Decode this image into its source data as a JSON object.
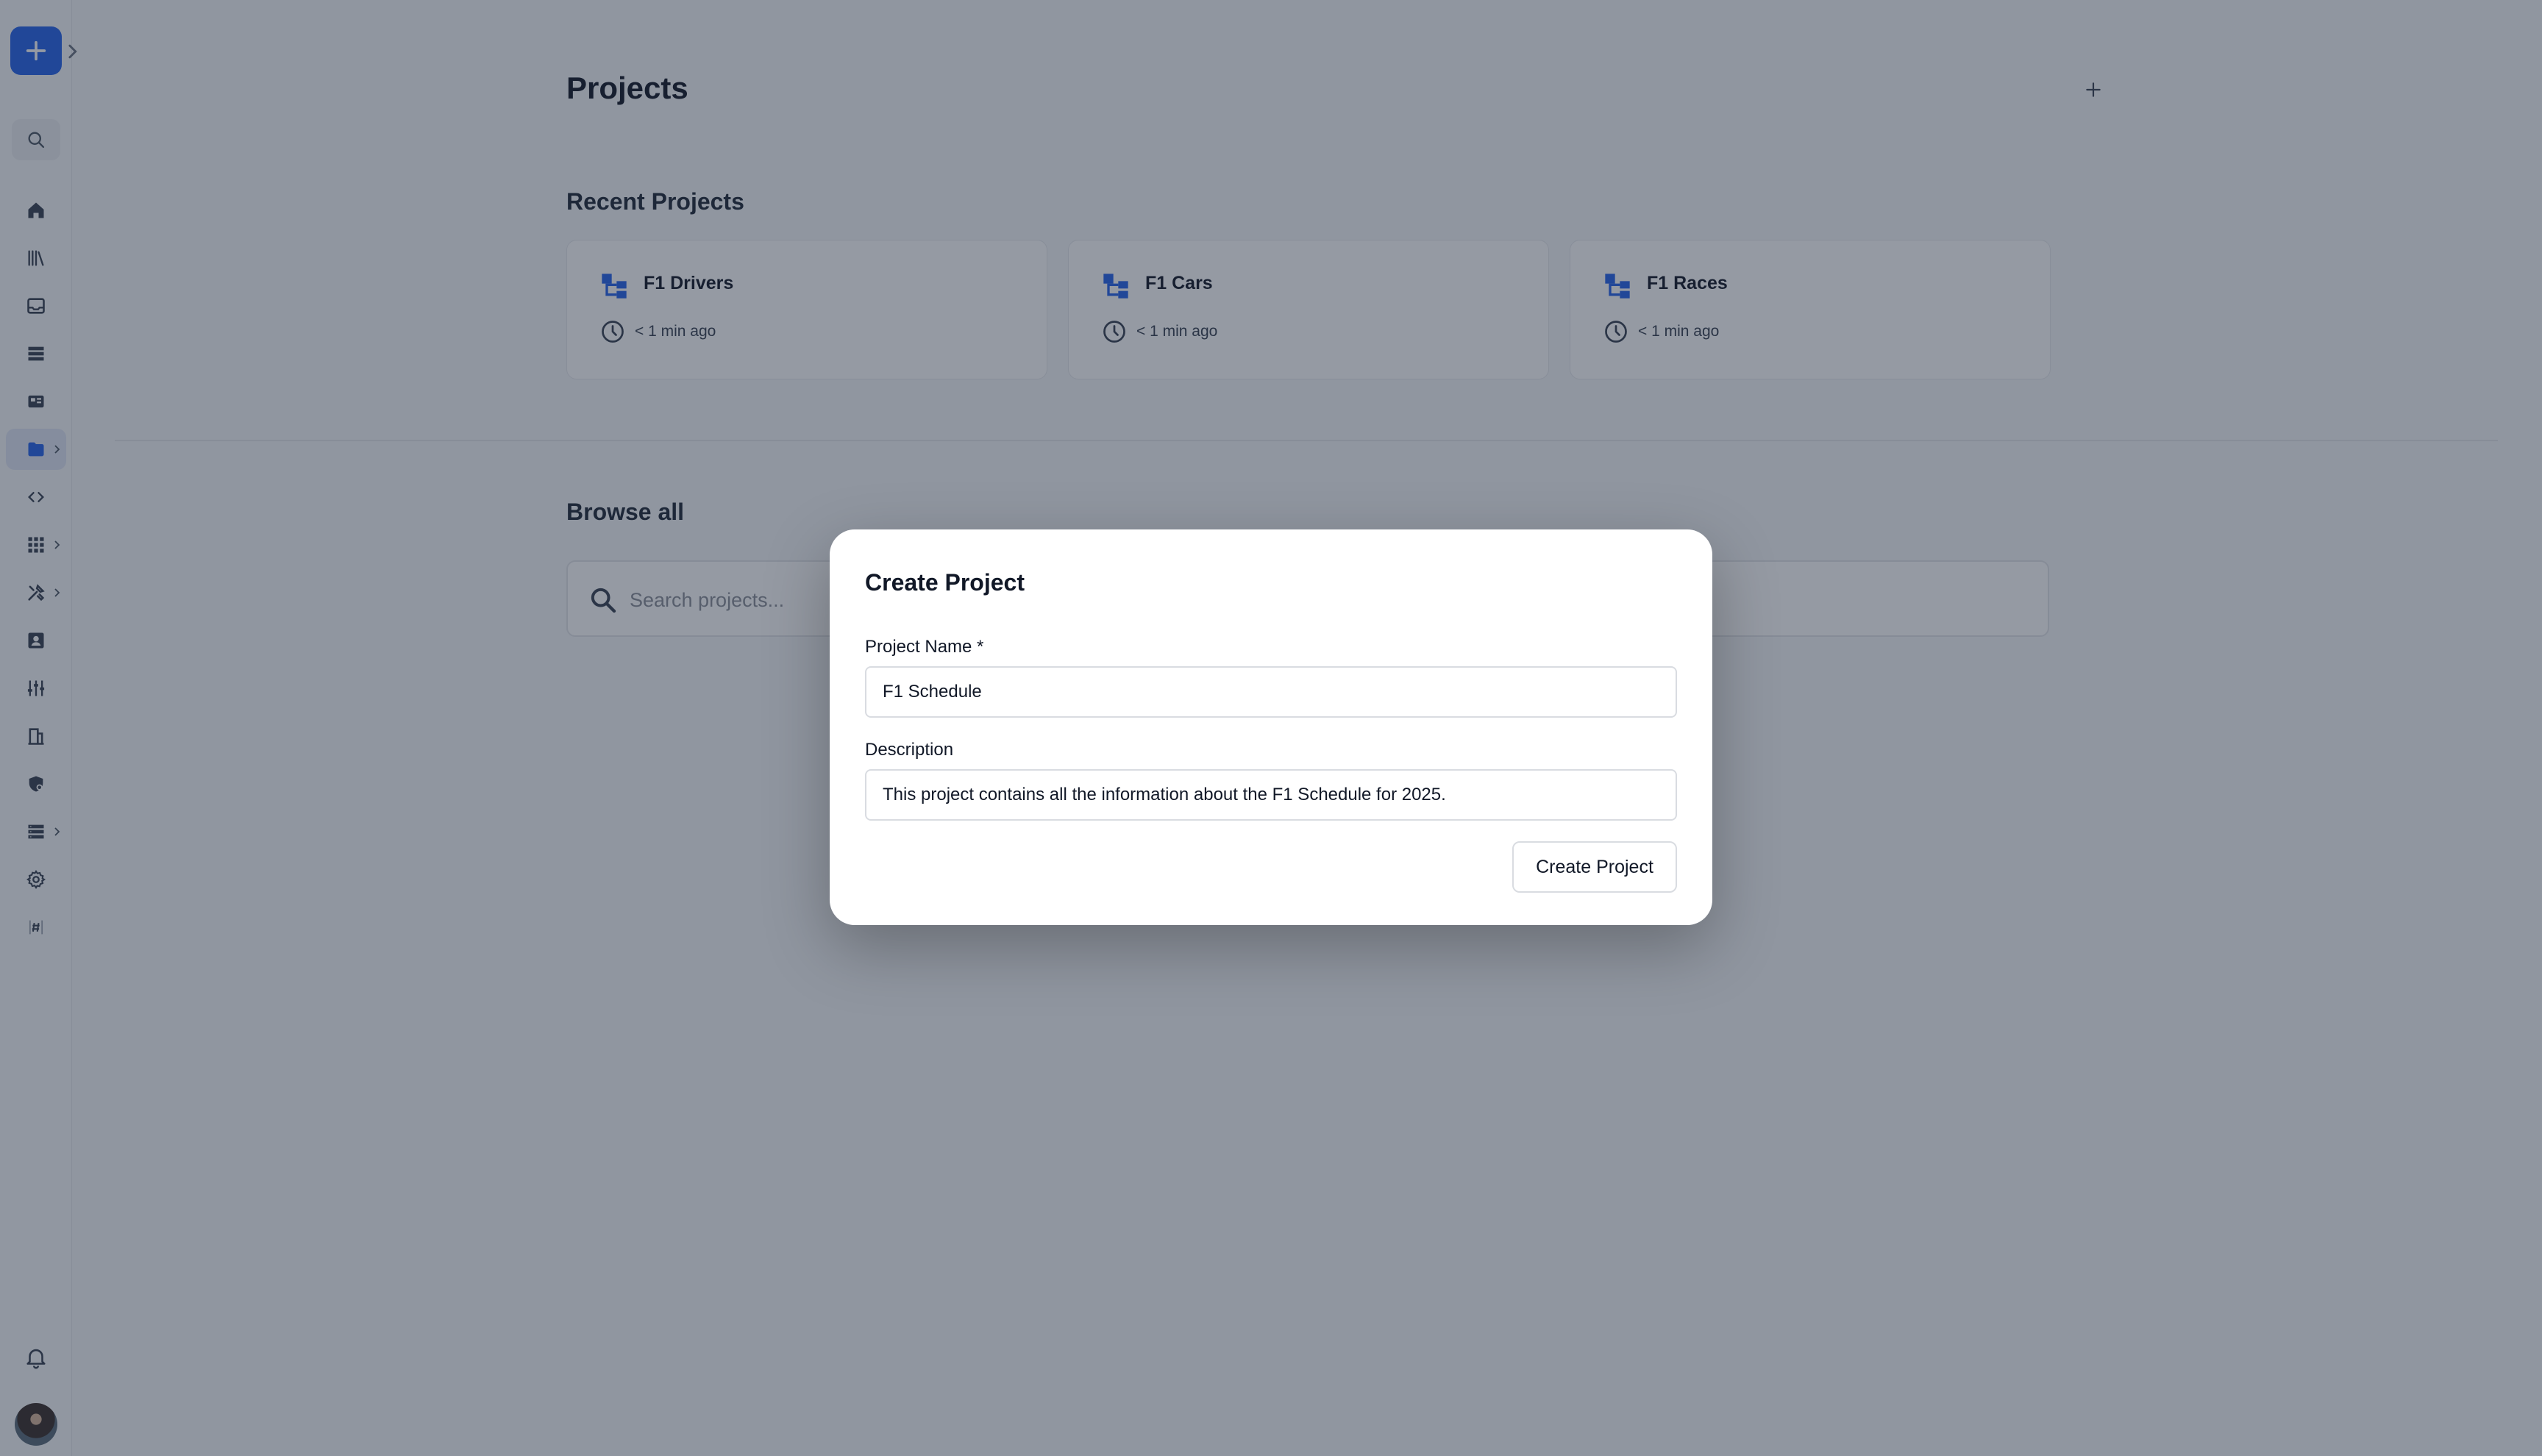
{
  "page": {
    "title": "Projects",
    "recent_title": "Recent Projects",
    "browse_title": "Browse all"
  },
  "recent_projects": [
    {
      "name": "F1 Drivers",
      "time": "< 1 min ago"
    },
    {
      "name": "F1 Cars",
      "time": "< 1 min ago"
    },
    {
      "name": "F1 Races",
      "time": "< 1 min ago"
    }
  ],
  "search": {
    "placeholder": "Search projects..."
  },
  "modal": {
    "title": "Create Project",
    "name_label": "Project Name *",
    "name_value": "F1 Schedule",
    "description_label": "Description",
    "description_value": "This project contains all the information about the F1 Schedule for 2025.",
    "submit_label": "Create Project"
  },
  "sidebar": {
    "items": [
      {
        "icon": "home-icon"
      },
      {
        "icon": "library-icon"
      },
      {
        "icon": "inbox-icon"
      },
      {
        "icon": "list-icon"
      },
      {
        "icon": "dashboard-icon"
      },
      {
        "icon": "folder-icon",
        "active": true
      },
      {
        "icon": "code-icon"
      },
      {
        "icon": "apps-grid-icon"
      },
      {
        "icon": "tools-icon"
      },
      {
        "icon": "contact-icon"
      },
      {
        "icon": "sliders-icon"
      },
      {
        "icon": "building-icon"
      },
      {
        "icon": "shield-icon"
      },
      {
        "icon": "database-icon"
      },
      {
        "icon": "gear-icon"
      },
      {
        "icon": "hash-icon"
      }
    ]
  },
  "colors": {
    "accent": "#2563eb",
    "icon": "#374151",
    "overlay": "#1e293b"
  }
}
